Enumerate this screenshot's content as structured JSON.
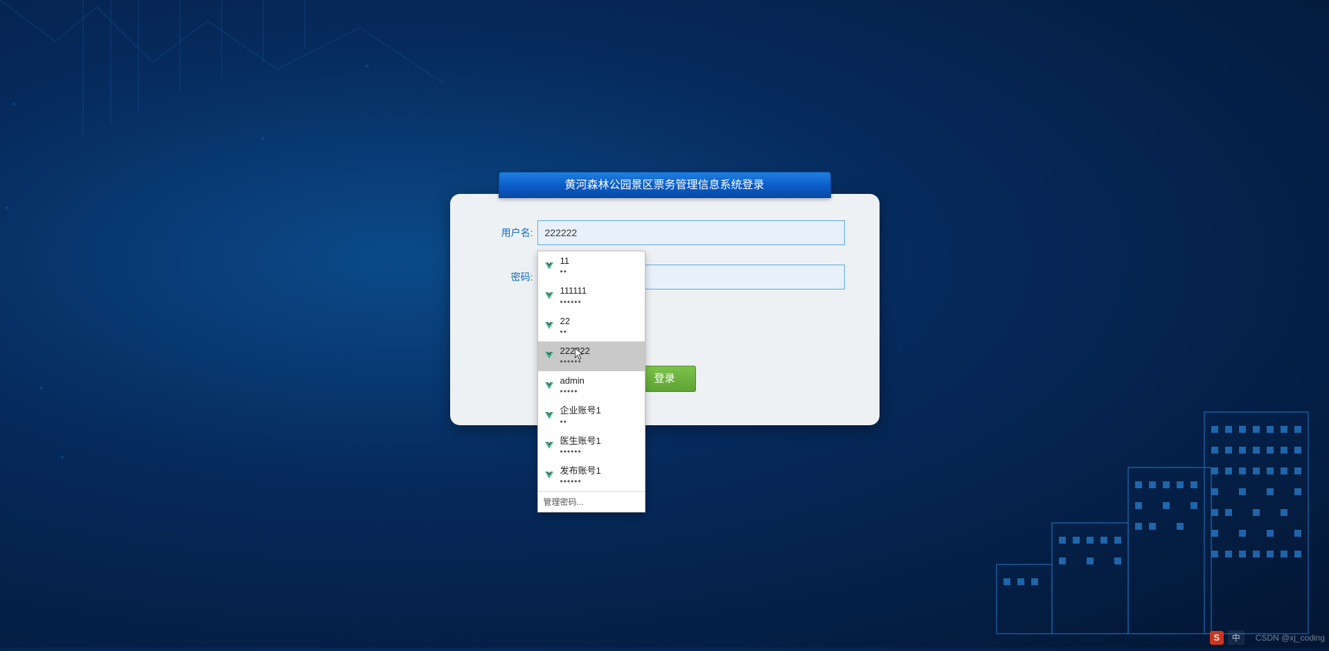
{
  "title": "黄河森林公园景区票务管理信息系统登录",
  "labels": {
    "username": "用户名:",
    "password": "密码:"
  },
  "inputs": {
    "username_value": "222222",
    "password_value": ""
  },
  "buttons": {
    "login": "登录"
  },
  "autocomplete": {
    "items": [
      {
        "user": "11",
        "mask": "••"
      },
      {
        "user": "111111",
        "mask": "••••••"
      },
      {
        "user": "22",
        "mask": "••"
      },
      {
        "user": "222222",
        "mask": "••••••"
      },
      {
        "user": "admin",
        "mask": "•••••"
      },
      {
        "user": "企业账号1",
        "mask": "••"
      },
      {
        "user": "医生账号1",
        "mask": "••••••"
      },
      {
        "user": "发布账号1",
        "mask": "••••••"
      }
    ],
    "selected_index": 3,
    "footer": "管理密码..."
  },
  "taskbar": {
    "ime_badge": "S",
    "ime_text": "中",
    "watermark": "CSDN @xj_coding"
  }
}
